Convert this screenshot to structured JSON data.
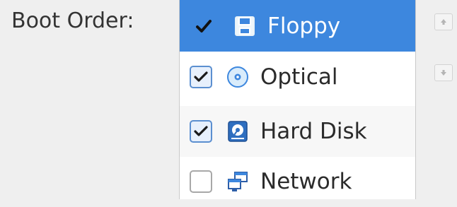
{
  "boot_order": {
    "label": "Boot Order:",
    "items": [
      {
        "label": "Floppy",
        "checked": true,
        "selected": true,
        "icon": "floppy-icon"
      },
      {
        "label": "Optical",
        "checked": true,
        "selected": false,
        "icon": "optical-disc-icon"
      },
      {
        "label": "Hard Disk",
        "checked": true,
        "selected": false,
        "icon": "hard-disk-icon"
      },
      {
        "label": "Network",
        "checked": false,
        "selected": false,
        "icon": "network-icon"
      }
    ]
  },
  "buttons": {
    "move_up_icon": "arrow-up-icon",
    "move_down_icon": "arrow-down-icon"
  },
  "colors": {
    "selection": "#3d87de",
    "checkbox_border": "#5b8fd0"
  }
}
